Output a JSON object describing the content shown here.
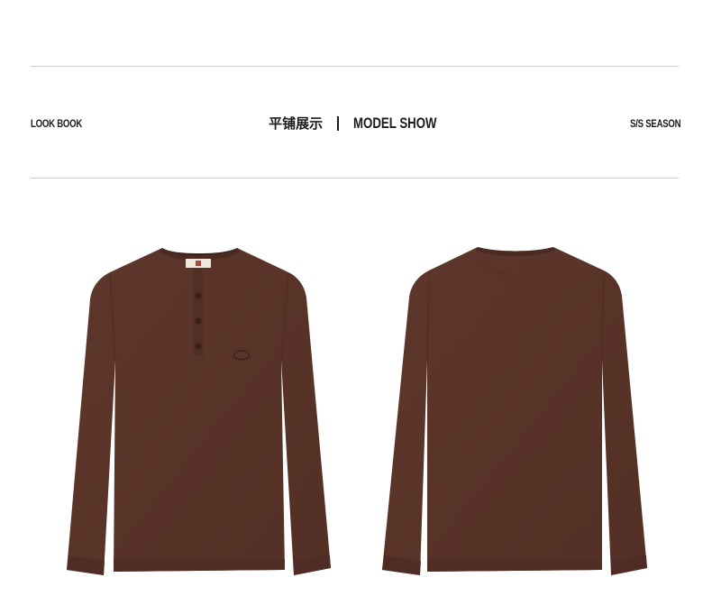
{
  "header": {
    "left_label": "LOOK BOOK",
    "center_title_cn": "平铺展示",
    "center_title_en": "MODEL SHOW",
    "right_label": "S/S SEASON"
  },
  "colors": {
    "divider": "#cfcfcf",
    "garment": "#5a3328",
    "garment_shadow": "#4a2a21",
    "text": "#1a1a1a"
  },
  "images": {
    "front": "brown-henley-front-flatlay",
    "back": "brown-henley-back-flatlay"
  }
}
